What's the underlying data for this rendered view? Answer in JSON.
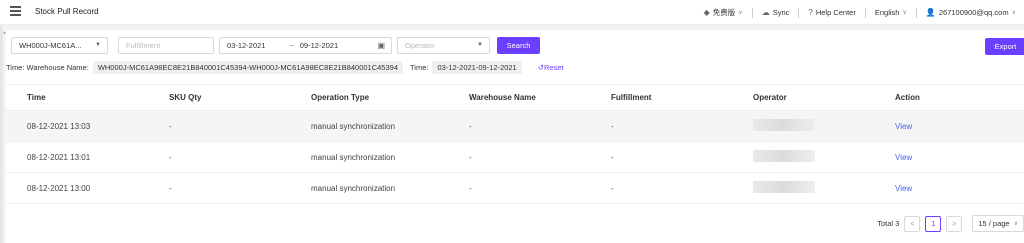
{
  "header": {
    "title": "Stock Pull Record",
    "plan_label": "免费版",
    "sync_label": "Sync",
    "help_label": "Help Center",
    "language_label": "English",
    "user_email": "267100900@qq.com"
  },
  "filters": {
    "warehouse_value": "WH000J-MC61A...",
    "fulfillment_placeholder": "Fulfillment",
    "date_start": "03-12-2021",
    "date_sep": "~",
    "date_end": "09-12-2021",
    "operator_placeholder": "Operator",
    "search_label": "Search",
    "export_label": "Export"
  },
  "active_filters": {
    "warehouse_prefix": "Time: Warehouse Name:",
    "warehouse_tag": "WH000J-MC61A98EC8E21B840001C45394-WH000J-MC61A98EC8E21B840001C45394",
    "time_prefix": "Time:",
    "time_tag": "03-12-2021-09-12-2021",
    "reset_label": "Reset"
  },
  "table": {
    "columns": [
      "Time",
      "SKU Qty",
      "Operation Type",
      "Warehouse Name",
      "Fulfillment",
      "Operator",
      "Action"
    ],
    "rows": [
      {
        "time": "08-12-2021 13:03",
        "sku_qty": "-",
        "operation_type": "manual synchronization",
        "warehouse_name": "-",
        "fulfillment": "-",
        "action": "View"
      },
      {
        "time": "08-12-2021 13:01",
        "sku_qty": "-",
        "operation_type": "manual synchronization",
        "warehouse_name": "-",
        "fulfillment": "-",
        "action": "View"
      },
      {
        "time": "08-12-2021 13:00",
        "sku_qty": "-",
        "operation_type": "manual synchronization",
        "warehouse_name": "-",
        "fulfillment": "-",
        "action": "View"
      }
    ]
  },
  "pagination": {
    "total_label": "Total 3",
    "current_page": "1",
    "page_size_label": "15 / page",
    "prev_glyph": "<",
    "next_glyph": ">"
  },
  "colors": {
    "accent": "#6b3fff",
    "link": "#4a63e0"
  }
}
